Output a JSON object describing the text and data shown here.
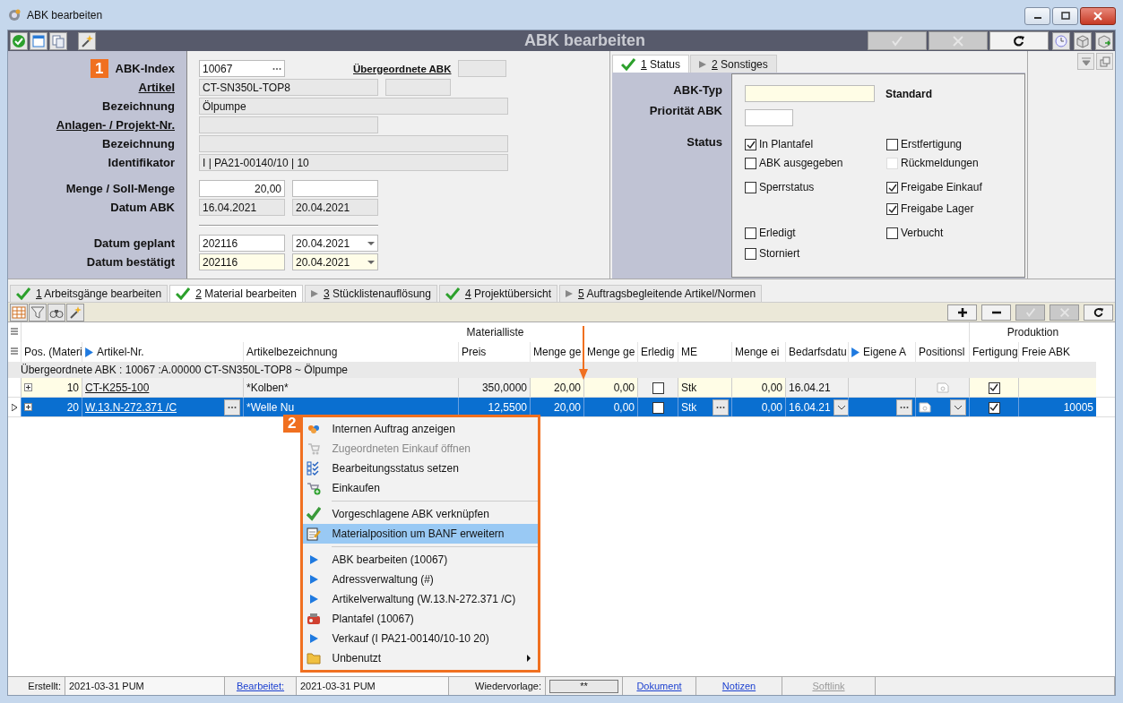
{
  "window": {
    "title": "ABK bearbeiten"
  },
  "toolbar": {
    "title": "ABK bearbeiten",
    "actions": [
      {
        "kind": "confirm",
        "disabled": true
      },
      {
        "kind": "cancel",
        "disabled": true
      },
      {
        "kind": "refresh",
        "disabled": false
      }
    ]
  },
  "form": {
    "badge": "1",
    "groups": [
      [
        {
          "label": "ABK-Index",
          "underlined": false,
          "inputs": [
            {
              "text": "10067",
              "kind": "lookup"
            }
          ],
          "side_label": "Übergeordnete ABK"
        },
        {
          "label": "Artikel",
          "underlined": true,
          "inputs": [
            {
              "text": "CT-SN350L-TOP8",
              "kind": "readonly"
            },
            {
              "kind": "readonly"
            }
          ]
        },
        {
          "label": "Bezeichnung",
          "underlined": false,
          "inputs": [
            {
              "text": "Ölpumpe",
              "kind": "readonly"
            }
          ]
        },
        {
          "label": "Anlagen- / Projekt-Nr.",
          "underlined": true,
          "inputs": [
            {
              "kind": "readonly"
            }
          ]
        },
        {
          "label": "Bezeichnung",
          "underlined": false,
          "inputs": [
            {
              "kind": "readonly"
            }
          ]
        },
        {
          "label": "Identifikator",
          "underlined": false,
          "inputs": [
            {
              "text": "I | PA21-00140/10 | 10",
              "kind": "readonly"
            }
          ]
        }
      ],
      [
        {
          "label": "Menge / Soll-Menge",
          "underlined": false,
          "inputs": [
            {
              "text": "20,00",
              "kind": "number"
            },
            {
              "kind": "input"
            }
          ]
        },
        {
          "label": "Datum ABK",
          "underlined": false,
          "inputs": [
            {
              "text": "16.04.2021",
              "kind": "readonly"
            },
            {
              "text": "20.04.2021",
              "kind": "readonly"
            }
          ]
        }
      ],
      [
        {
          "label": "Datum geplant",
          "underlined": false,
          "inputs": [
            {
              "text": "202116",
              "kind": "input"
            },
            {
              "text": "20.04.2021",
              "kind": "dropdown"
            }
          ]
        },
        {
          "label": "Datum bestätigt",
          "underlined": false,
          "inputs": [
            {
              "text": "202116",
              "kind": "input",
              "highlighted": true
            },
            {
              "text": "20.04.2021",
              "kind": "dropdown",
              "highlighted": true
            }
          ]
        }
      ]
    ]
  },
  "detail_tabs": [
    {
      "key": "1",
      "label": "Status",
      "kind": "done",
      "selected": true
    },
    {
      "key": "2",
      "label": "Sonstiges",
      "kind": "pending",
      "selected": false
    }
  ],
  "status_panel": {
    "type_label": "ABK-Typ",
    "type_value": "Standard",
    "priority_label": "Priorität ABK",
    "status_label": "Status",
    "flags": [
      {
        "label": "In Plantafel",
        "checked": true,
        "disabled": false
      },
      {
        "label": "Erstfertigung",
        "checked": false,
        "disabled": false
      },
      {
        "label": "ABK ausgegeben",
        "checked": false,
        "disabled": false
      },
      {
        "label": "Rückmeldungen",
        "checked": false,
        "disabled": true
      },
      {
        "label": "Sperrstatus",
        "checked": false,
        "disabled": false
      },
      {
        "label": "Freigabe Einkauf",
        "checked": true,
        "disabled": false
      },
      {
        "label": "Freigabe Lager",
        "checked": true,
        "disabled": false
      },
      {
        "label": "Erledigt",
        "checked": false,
        "disabled": false
      },
      {
        "label": "Verbucht",
        "checked": false,
        "disabled": false
      },
      {
        "label": "Storniert",
        "checked": false,
        "disabled": false
      }
    ]
  },
  "tabs": [
    {
      "key": "1",
      "label": "Arbeitsgänge bearbeiten",
      "kind": "done",
      "selected": false
    },
    {
      "key": "2",
      "label": "Material bearbeiten",
      "kind": "done",
      "selected": true
    },
    {
      "key": "3",
      "label": "Stücklistenauflösung",
      "kind": "pending",
      "selected": false
    },
    {
      "key": "4",
      "label": "Projektübersicht",
      "kind": "done",
      "selected": false
    },
    {
      "key": "5",
      "label": "Auftragsbegleitende Artikel/Normen",
      "kind": "pending",
      "selected": false
    }
  ],
  "table": {
    "column_groups": [
      "Materialliste",
      "Produktion"
    ],
    "columns": [
      {
        "label": "Pos. (Materi",
        "kind": "number",
        "editable": true
      },
      {
        "label": "Artikel-Nr.",
        "kind": "link",
        "arrow": true,
        "lookup": true,
        "editable": false
      },
      {
        "label": "Artikelbezeichnung",
        "kind": "text",
        "editable": false
      },
      {
        "label": "Preis",
        "kind": "number",
        "editable": false
      },
      {
        "label": "Menge ge",
        "kind": "number",
        "editable": true
      },
      {
        "label": "Menge ge",
        "kind": "number",
        "editable": true
      },
      {
        "label": "Erledig",
        "kind": "check",
        "editable": false
      },
      {
        "label": "ME",
        "kind": "text",
        "editable": true,
        "lookup": true
      },
      {
        "label": "Menge ei",
        "kind": "number",
        "editable": true
      },
      {
        "label": "Bedarfsdatu",
        "kind": "text",
        "dropdown": true,
        "editable": false
      },
      {
        "label": "Eigene A",
        "kind": "text",
        "arrow": true,
        "lookup": true,
        "editable": false
      },
      {
        "label": "Positionsl",
        "kind": "doc",
        "dropdown": true,
        "editable": false
      },
      {
        "label": "Fertigung",
        "kind": "check",
        "editable": true
      },
      {
        "label": "Freie ABK",
        "kind": "number",
        "editable": true
      }
    ],
    "group_row": "Übergeordnete ABK :  10067 :A.00000 CT-SN350L-TOP8 ~ Ölpumpe",
    "rows": [
      {
        "selected": false,
        "cells": [
          {
            "text": "10"
          },
          {
            "text": "CT-K255-100"
          },
          {
            "text": "*Kolben*"
          },
          {
            "text": "350,0000"
          },
          {
            "text": "20,00"
          },
          {
            "text": "0,00"
          },
          {
            "checked": false
          },
          {
            "text": "Stk"
          },
          {
            "text": "0,00"
          },
          {
            "text": "16.04.21"
          },
          {},
          {},
          {
            "checked": true
          },
          {}
        ]
      },
      {
        "selected": true,
        "cells": [
          {
            "text": "20"
          },
          {
            "text": "W.13.N-272.371 /C"
          },
          {
            "text": "*Welle Nu"
          },
          {
            "text": "12,5500"
          },
          {
            "text": "20,00"
          },
          {
            "text": "0,00"
          },
          {
            "checked": false
          },
          {
            "text": "Stk"
          },
          {
            "text": "0,00"
          },
          {
            "text": "16.04.21"
          },
          {},
          {},
          {
            "checked": true
          },
          {
            "text": "10005"
          }
        ]
      }
    ]
  },
  "context_menu": {
    "badge": "2",
    "groups": [
      [
        {
          "label": "Internen Auftrag anzeigen",
          "kind": "order",
          "disabled": false,
          "selected": false
        },
        {
          "label": "Zugeordneten Einkauf öffnen",
          "kind": "purchase",
          "disabled": true,
          "selected": false
        },
        {
          "label": "Bearbeitungsstatus setzen",
          "kind": "status",
          "disabled": false,
          "selected": false
        },
        {
          "label": "Einkaufen",
          "kind": "buy",
          "disabled": false,
          "selected": false
        }
      ],
      [
        {
          "label": "Vorgeschlagene ABK verknüpfen",
          "kind": "link",
          "disabled": false,
          "selected": false
        },
        {
          "label": "Materialposition um BANF erweitern",
          "kind": "note",
          "disabled": false,
          "selected": true
        }
      ],
      [
        {
          "label": "ABK bearbeiten  (10067)",
          "kind": "navigate",
          "disabled": false,
          "selected": false
        },
        {
          "label": "Adressverwaltung  (#)",
          "kind": "navigate",
          "disabled": false,
          "selected": false
        },
        {
          "label": "Artikelverwaltung  (W.13.N-272.371 /C)",
          "kind": "navigate",
          "disabled": false,
          "selected": false
        },
        {
          "label": "Plantafel  (10067)",
          "kind": "plan",
          "disabled": false,
          "selected": false
        },
        {
          "label": "Verkauf  (I PA21-00140/10-10 20)",
          "kind": "navigate",
          "disabled": false,
          "selected": false
        },
        {
          "label": "Unbenutzt",
          "kind": "folder",
          "disabled": false,
          "selected": false,
          "submenu": true
        }
      ]
    ]
  },
  "status_bar": [
    {
      "text": "Erstellt:",
      "kind": "label"
    },
    {
      "text": "2021-03-31  PUM",
      "kind": "value"
    },
    {
      "text": "Bearbeitet:",
      "kind": "link"
    },
    {
      "text": "2021-03-31  PUM",
      "kind": "value"
    },
    {
      "text": "Wiedervorlage:",
      "kind": "label"
    },
    {
      "text": "**",
      "kind": "button"
    },
    {
      "text": "Dokument",
      "kind": "link"
    },
    {
      "text": "Notizen",
      "kind": "link"
    },
    {
      "text": "Softlink",
      "kind": "disabled_link"
    }
  ]
}
